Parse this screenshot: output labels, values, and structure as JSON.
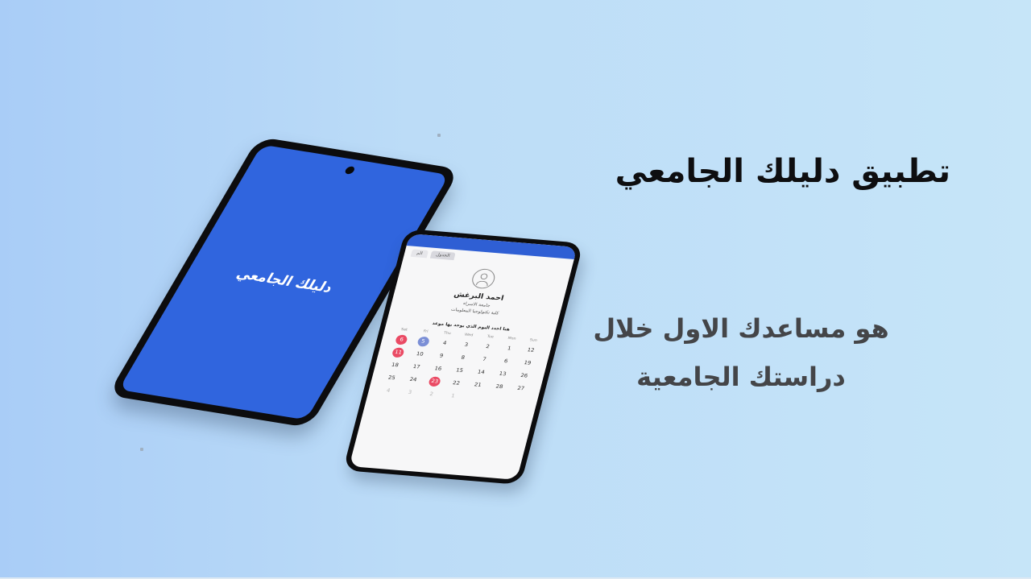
{
  "headline": "تطبيق دليلك الجامعي",
  "tagline": {
    "line1": "هو مساعدك الاول خلال",
    "line2": "دراستك الجامعية"
  },
  "phone_splash": {
    "app_name": "دليلك الجامعي",
    "background_color": "#3065de"
  },
  "phone_calendar": {
    "tabs": [
      "الجدول",
      "الم"
    ],
    "profile": {
      "name": "احمد البرغش",
      "university": "جامعة الاسراء",
      "faculty": "كلية تكنولوجيا المعلومات"
    },
    "calendar_title": "هنا احدد اليوم الذي يوجد بها موعد",
    "weekdays": [
      "Sat",
      "Fri",
      "Thu",
      "Wed",
      "Tue",
      "Mon",
      "Sun"
    ],
    "days": [
      {
        "label": "6",
        "style": "red"
      },
      {
        "label": "5",
        "style": "blue"
      },
      {
        "label": "4",
        "style": ""
      },
      {
        "label": "3",
        "style": ""
      },
      {
        "label": "2",
        "style": ""
      },
      {
        "label": "1",
        "style": ""
      },
      {
        "label": "12",
        "style": ""
      },
      {
        "label": "11",
        "style": "red"
      },
      {
        "label": "10",
        "style": ""
      },
      {
        "label": "9",
        "style": ""
      },
      {
        "label": "8",
        "style": ""
      },
      {
        "label": "7",
        "style": ""
      },
      {
        "label": "6",
        "style": ""
      },
      {
        "label": "19",
        "style": ""
      },
      {
        "label": "18",
        "style": ""
      },
      {
        "label": "17",
        "style": ""
      },
      {
        "label": "16",
        "style": ""
      },
      {
        "label": "15",
        "style": ""
      },
      {
        "label": "14",
        "style": ""
      },
      {
        "label": "13",
        "style": ""
      },
      {
        "label": "26",
        "style": ""
      },
      {
        "label": "25",
        "style": ""
      },
      {
        "label": "24",
        "style": ""
      },
      {
        "label": "23",
        "style": "red"
      },
      {
        "label": "22",
        "style": ""
      },
      {
        "label": "21",
        "style": ""
      },
      {
        "label": "28",
        "style": ""
      },
      {
        "label": "27",
        "style": ""
      },
      {
        "label": "4",
        "style": "muted"
      },
      {
        "label": "3",
        "style": "muted"
      },
      {
        "label": "2",
        "style": "muted"
      },
      {
        "label": "1",
        "style": "muted"
      },
      {
        "label": "",
        "style": ""
      },
      {
        "label": "",
        "style": ""
      },
      {
        "label": "",
        "style": ""
      }
    ],
    "highlight_colors": {
      "red": "#ea4a64",
      "blue": "#7b8fd6"
    }
  }
}
